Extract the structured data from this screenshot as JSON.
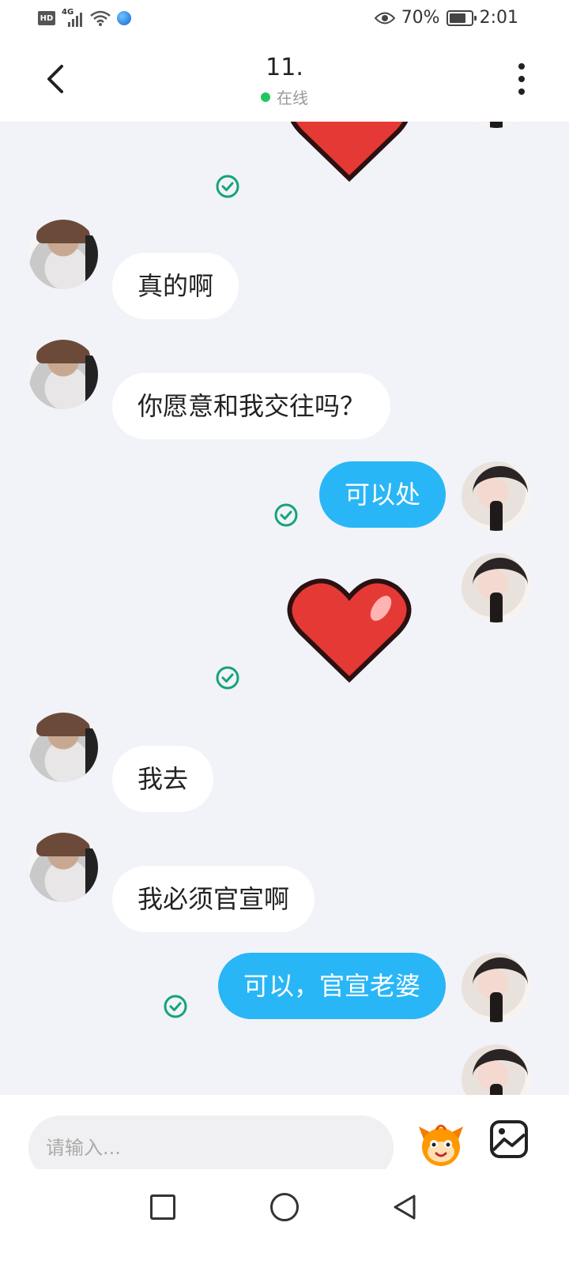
{
  "status_bar": {
    "hd": "HD",
    "network": "4G",
    "battery_percent": "70%",
    "battery_level": 0.7,
    "time": "2:01"
  },
  "header": {
    "title": "11.",
    "status": "在线",
    "status_color": "#22c55e"
  },
  "messages": [
    {
      "side": "out",
      "type": "sticker",
      "sticker": "heart"
    },
    {
      "side": "in",
      "type": "text",
      "text": "真的啊"
    },
    {
      "side": "in",
      "type": "text",
      "text": "你愿意和我交往吗？"
    },
    {
      "side": "out",
      "type": "text",
      "text": "可以处",
      "read": true
    },
    {
      "side": "out",
      "type": "sticker",
      "sticker": "heart",
      "read": true
    },
    {
      "side": "in",
      "type": "text",
      "text": "我去"
    },
    {
      "side": "in",
      "type": "text",
      "text": "我必须官宣啊"
    },
    {
      "side": "out",
      "type": "text",
      "text": "可以，官宣老婆",
      "read": true
    }
  ],
  "composer": {
    "placeholder": "请输入..."
  },
  "colors": {
    "outgoing_bubble": "#29b6f6",
    "incoming_bubble": "#ffffff",
    "read_check": "#16a37a",
    "background": "#f1f3f8"
  },
  "icons": {
    "back": "chevron-left-icon",
    "more": "more-vertical-icon",
    "emoji": "emoji-sticker-icon",
    "image": "image-icon",
    "read": "check-circle-icon",
    "sticker": "heart-sticker"
  }
}
